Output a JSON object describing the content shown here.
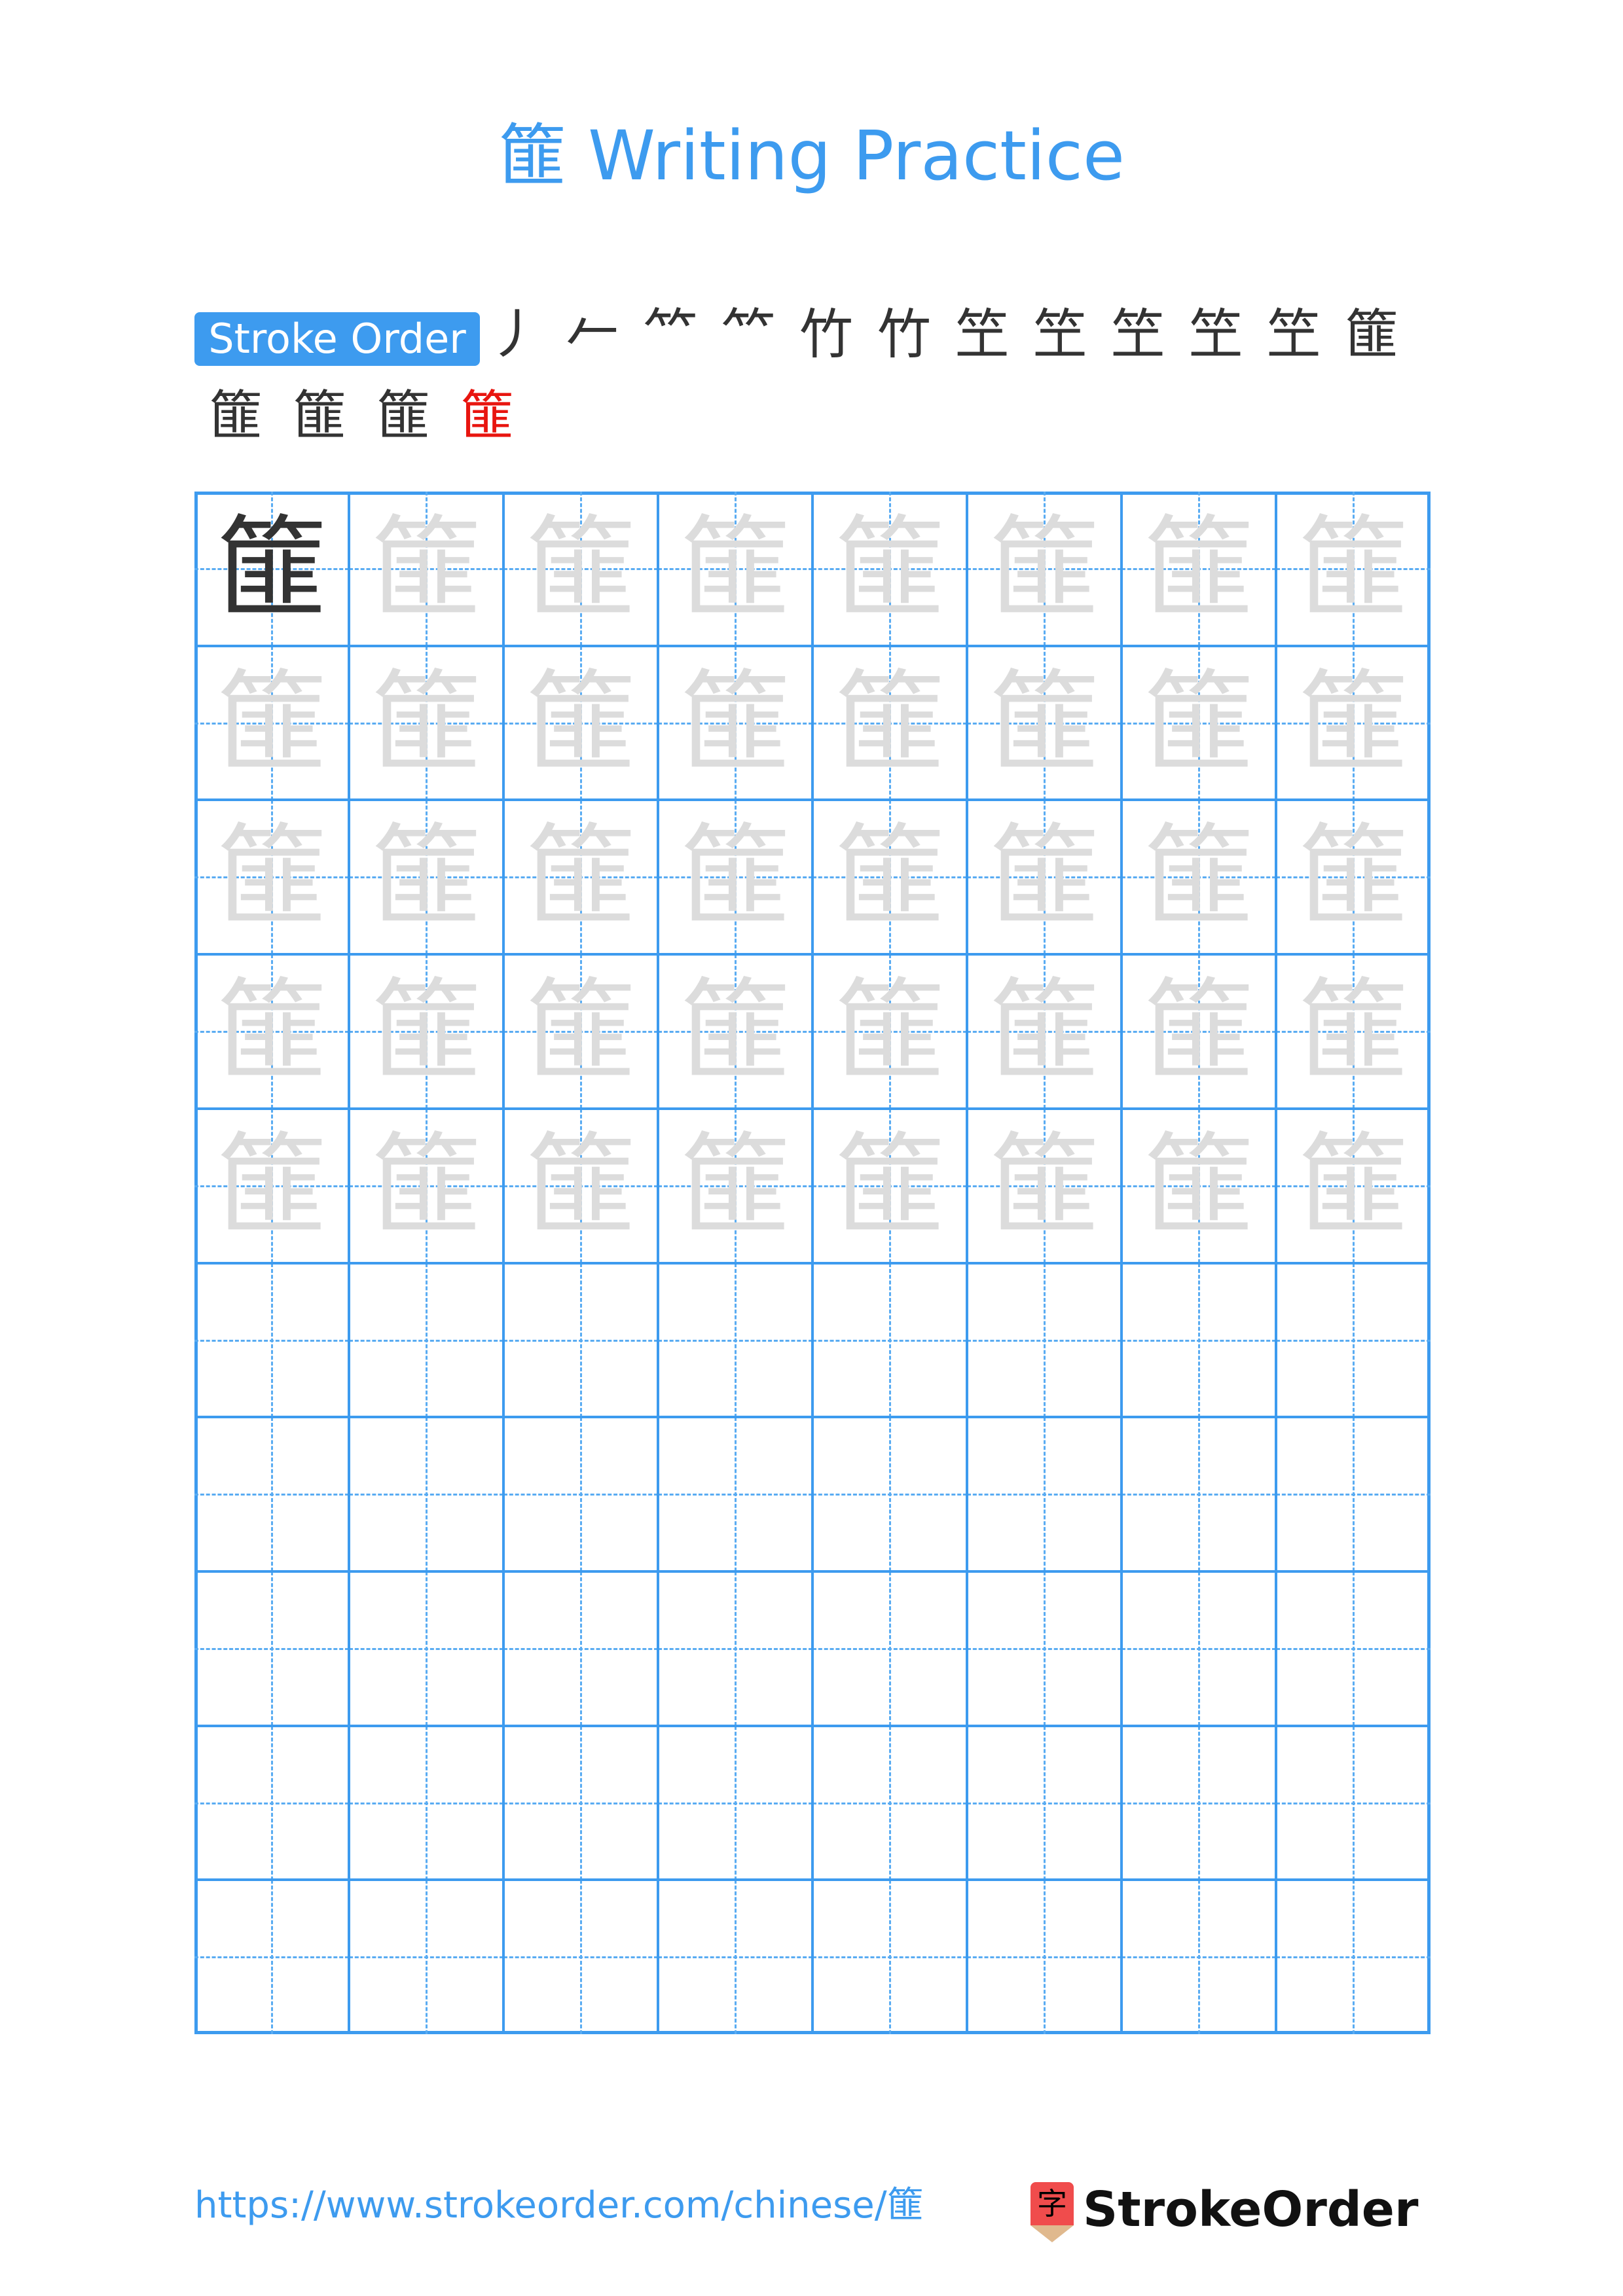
{
  "page": {
    "character": "篚",
    "title": "篚 Writing Practice",
    "stroke_order_label": "Stroke Order",
    "stroke_count": 16,
    "stroke_steps": [
      {
        "step": 1,
        "glyph": "丿"
      },
      {
        "step": 2,
        "glyph": "𠂉"
      },
      {
        "step": 3,
        "glyph": "𥫗"
      },
      {
        "step": 4,
        "glyph": "𥫗"
      },
      {
        "step": 5,
        "glyph": "竹"
      },
      {
        "step": 6,
        "glyph": "竹"
      },
      {
        "step": 7,
        "glyph": "笁"
      },
      {
        "step": 8,
        "glyph": "笁"
      },
      {
        "step": 9,
        "glyph": "笁"
      },
      {
        "step": 10,
        "glyph": "笁"
      },
      {
        "step": 11,
        "glyph": "笁"
      },
      {
        "step": 12,
        "glyph": "篚"
      },
      {
        "step": 13,
        "glyph": "篚"
      },
      {
        "step": 14,
        "glyph": "篚"
      },
      {
        "step": 15,
        "glyph": "篚"
      },
      {
        "step": 16,
        "glyph": "篚"
      }
    ],
    "grid": {
      "columns": 8,
      "rows": 10,
      "model_cells": 1,
      "trace_rows": 5,
      "empty_rows": 5
    },
    "colors": {
      "accent": "#3d9bef",
      "stroke_highlight": "#e8150f",
      "model_char": "#333333",
      "trace_char": "#dcdcdc",
      "logo_red": "#f04c4c",
      "logo_tan": "#e0b98e"
    },
    "footer": {
      "url": "https://www.strokeorder.com/chinese/篚",
      "logo_text": "StrokeOrder",
      "logo_icon_glyph": "字"
    }
  }
}
